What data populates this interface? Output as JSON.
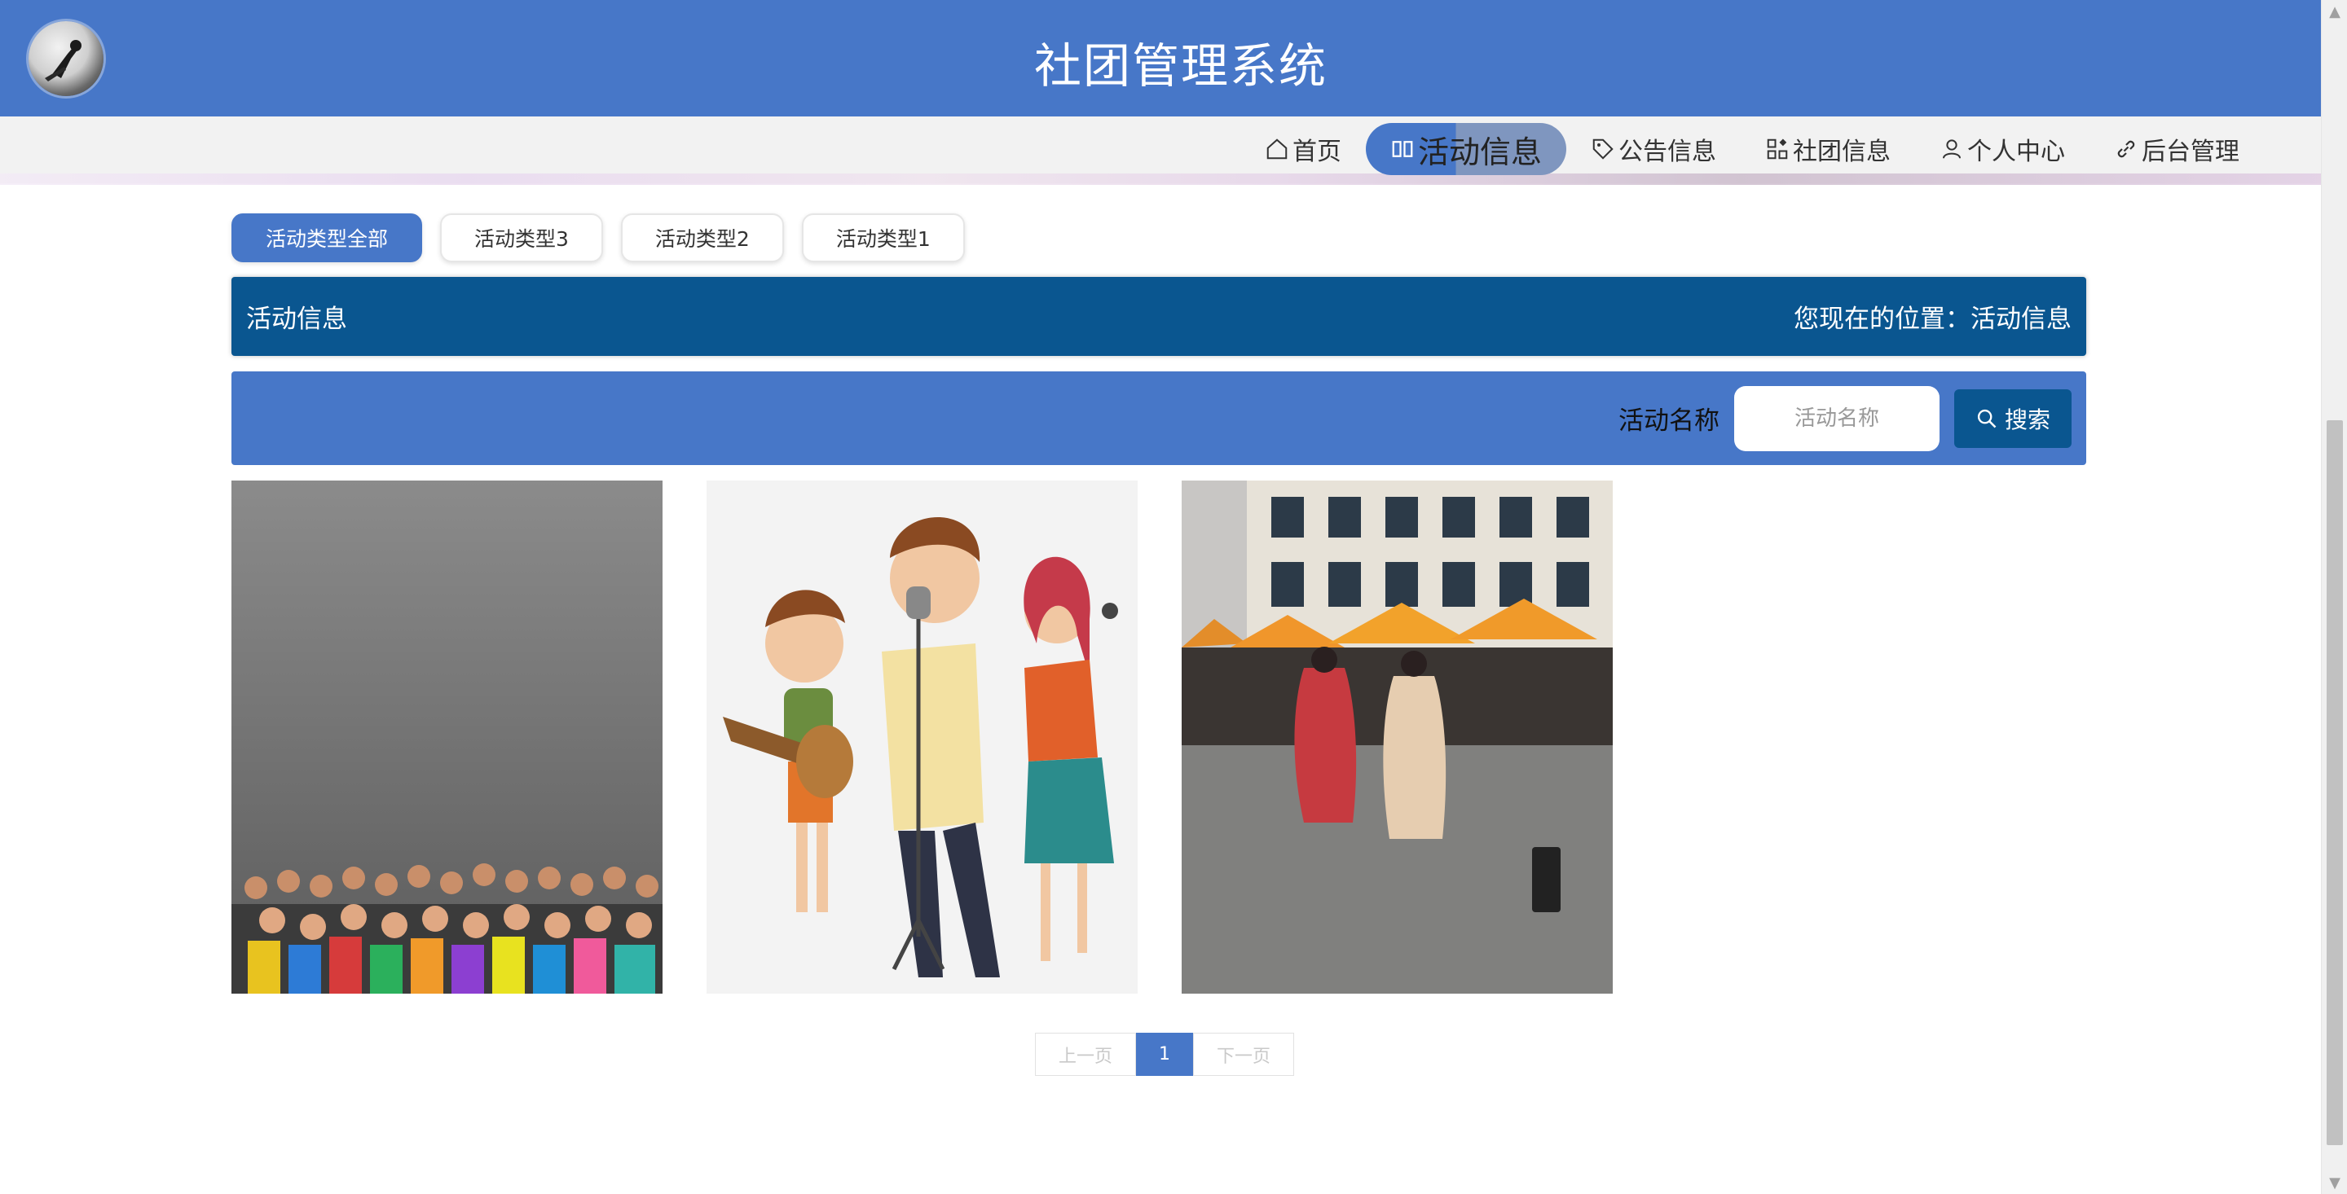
{
  "header": {
    "title": "社团管理系统"
  },
  "nav": [
    {
      "label": "首页",
      "icon": "home-icon"
    },
    {
      "label": "活动信息",
      "icon": "book-icon",
      "active": true
    },
    {
      "label": "公告信息",
      "icon": "tag-icon"
    },
    {
      "label": "社团信息",
      "icon": "grid-icon"
    },
    {
      "label": "个人中心",
      "icon": "user-icon"
    },
    {
      "label": "后台管理",
      "icon": "link-icon"
    }
  ],
  "type_tabs": [
    {
      "label": "活动类型全部",
      "active": true
    },
    {
      "label": "活动类型3"
    },
    {
      "label": "活动类型2"
    },
    {
      "label": "活动类型1"
    }
  ],
  "breadcrumb": {
    "left": "活动信息",
    "right": "您现在的位置：活动信息"
  },
  "search": {
    "label": "活动名称",
    "placeholder": "活动名称",
    "button": "搜索"
  },
  "pagination": {
    "prev": "上一页",
    "current": "1",
    "next": "下一页"
  },
  "colors": {
    "primary": "#4777c8",
    "dark": "#0a5690"
  }
}
